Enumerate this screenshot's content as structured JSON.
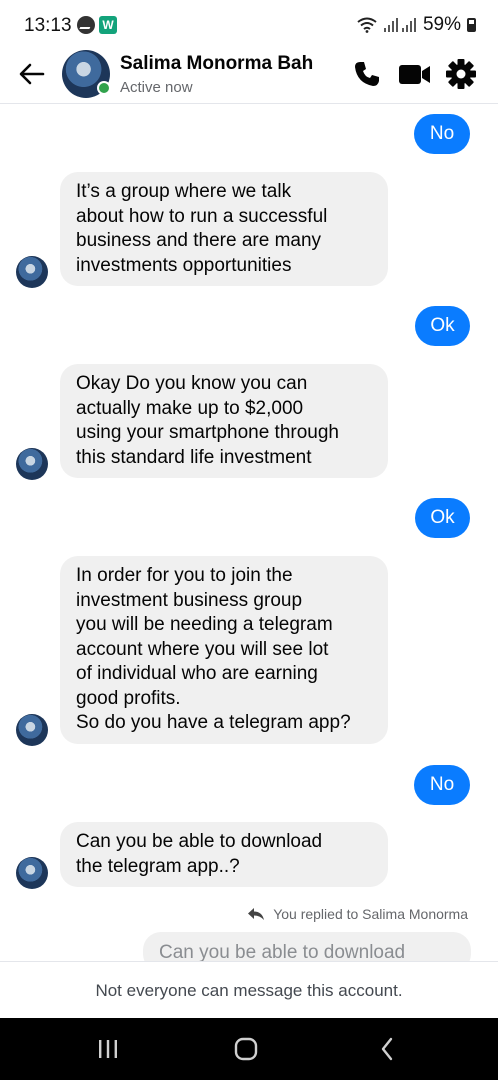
{
  "status_bar": {
    "time": "13:13",
    "battery": "59%",
    "icons": [
      "messenger-icon",
      "app-w-icon",
      "wifi-icon",
      "signal-icon",
      "battery-icon"
    ],
    "w_label": "W"
  },
  "header": {
    "contact_name": "Salima Monorma Bah",
    "status": "Active now",
    "icons": [
      "back-arrow-icon",
      "phone-icon",
      "video-icon",
      "gear-icon"
    ]
  },
  "messages": [
    {
      "direction": "outgoing",
      "text": "No"
    },
    {
      "direction": "incoming",
      "text": "It’s a group where we talk\nabout how to run a successful\nbusiness and there are many\ninvestments opportunities"
    },
    {
      "direction": "outgoing",
      "text": "Ok"
    },
    {
      "direction": "incoming",
      "text": "Okay Do you know you can\nactually make up to $2,000\nusing your smartphone through\nthis standard life investment"
    },
    {
      "direction": "outgoing",
      "text": "Ok"
    },
    {
      "direction": "incoming",
      "text": "In order for you to join the\ninvestment business group\nyou will be needing a telegram\naccount where you will see lot\nof individual who are earning\ngood profits.\nSo do you have a telegram app?"
    },
    {
      "direction": "outgoing",
      "text": "No"
    },
    {
      "direction": "incoming",
      "text": "Can you be able to download\nthe telegram app..?"
    }
  ],
  "reply": {
    "note": "You replied to Salima Monorma",
    "preview": "Can you be able to download"
  },
  "notice": "Not everyone can message this account.",
  "nav_bar": {
    "icons": [
      "recent-apps-icon",
      "home-icon",
      "back-icon"
    ]
  },
  "colors": {
    "outgoing_bubble": "#0a7cff",
    "incoming_bubble": "#f0f0f0",
    "online": "#31a24c",
    "secondary_text": "#65676b"
  }
}
